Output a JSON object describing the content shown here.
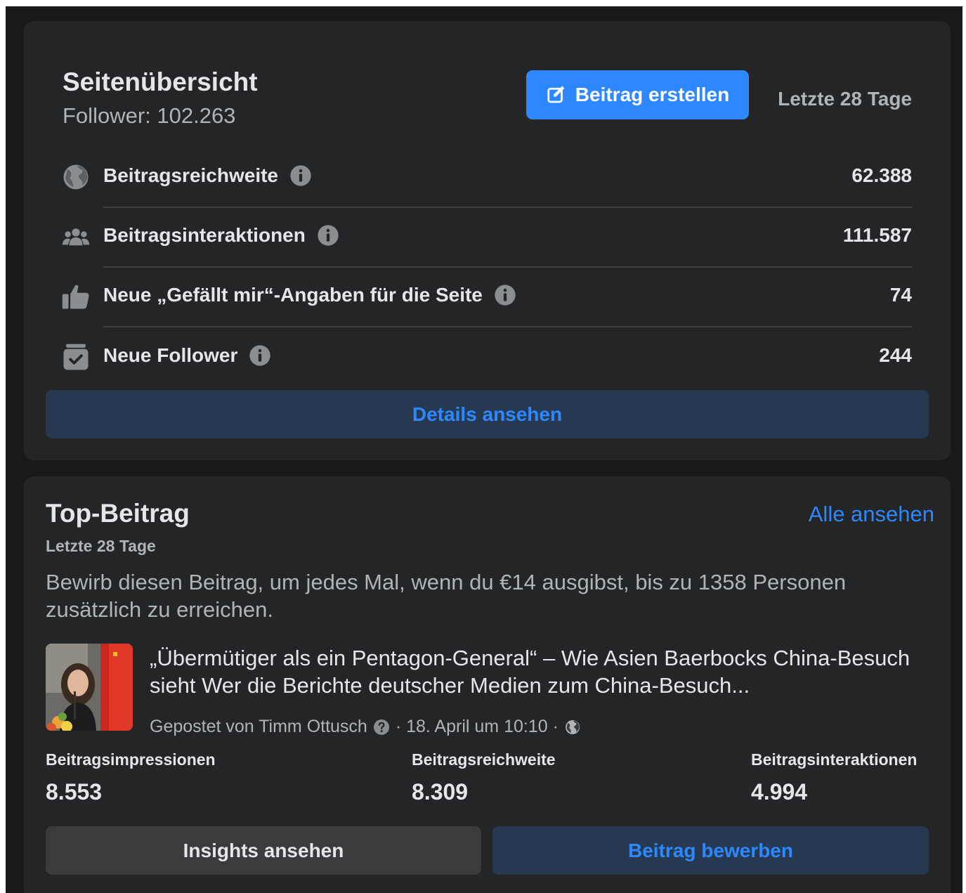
{
  "overview": {
    "title": "Seitenübersicht",
    "followers": "Follower: 102.263",
    "create_button": "Beitrag erstellen",
    "period": "Letzte 28 Tage",
    "metrics": [
      {
        "label": "Beitragsreichweite",
        "value": "62.388",
        "icon": "globe-icon"
      },
      {
        "label": "Beitragsinteraktionen",
        "value": "111.587",
        "icon": "people-icon"
      },
      {
        "label": "Neue „Gefällt mir“-Angaben für die Seite",
        "value": "74",
        "icon": "thumbs-up-icon"
      },
      {
        "label": "Neue Follower",
        "value": "244",
        "icon": "follower-check-icon"
      }
    ],
    "details_button": "Details ansehen"
  },
  "top_post": {
    "title": "Top-Beitrag",
    "see_all": "Alle ansehen",
    "period": "Letzte 28 Tage",
    "promo_text": "Bewirb diesen Beitrag, um jedes Mal, wenn du €14 ausgibst, bis zu 1358 Personen zusätzlich zu erreichen.",
    "post": {
      "headline": "„Übermütiger als ein Pentagon-General“ – Wie Asien Baerbocks China-Besuch sieht Wer die Berichte deutscher Medien zum China-Besuch...",
      "author": "Gepostet von Timm Ottusch",
      "date": "· 18. April um 10:10 ·"
    },
    "stats": [
      {
        "label": "Beitragsimpressionen",
        "value": "8.553"
      },
      {
        "label": "Beitragsreichweite",
        "value": "8.309"
      },
      {
        "label": "Beitragsinteraktionen",
        "value": "4.994"
      }
    ],
    "insights_button": "Insights ansehen",
    "promote_button": "Beitrag bewerben"
  },
  "colors": {
    "background": "#18191a",
    "card": "#242526",
    "primary_blue": "#2d88ff",
    "secondary_button": "#263951",
    "text_primary": "#e4e6eb",
    "text_secondary": "#b0b3b8"
  }
}
